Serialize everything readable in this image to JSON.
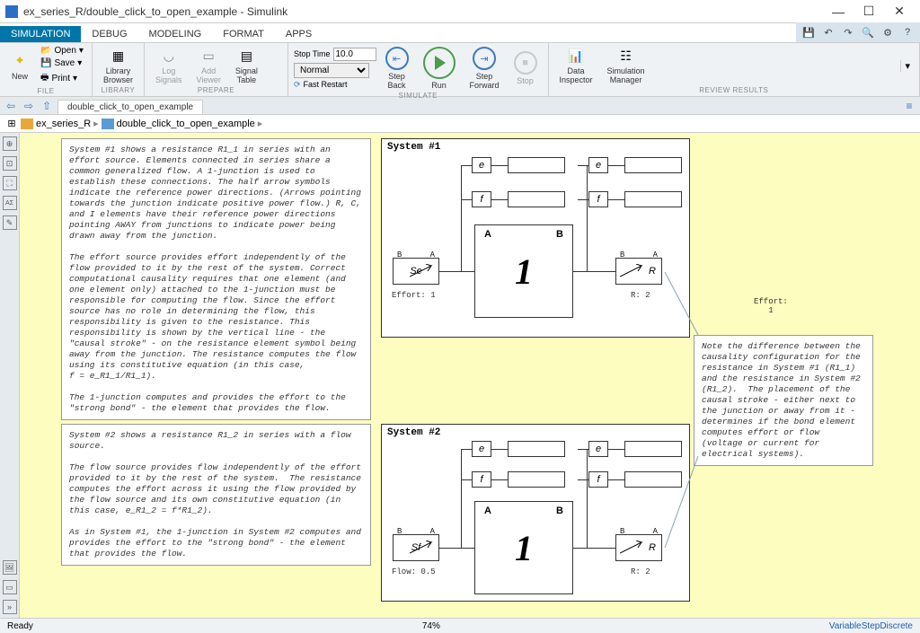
{
  "window": {
    "title": "ex_series_R/double_click_to_open_example - Simulink"
  },
  "tabs": {
    "simulation": "SIMULATION",
    "debug": "DEBUG",
    "modeling": "MODELING",
    "format": "FORMAT",
    "apps": "APPS"
  },
  "toolstrip": {
    "file": {
      "label": "FILE",
      "new": "New",
      "open": "Open",
      "save": "Save",
      "print": "Print"
    },
    "library": {
      "label": "LIBRARY",
      "browser": "Library\nBrowser"
    },
    "prepare": {
      "label": "PREPARE",
      "log": "Log\nSignals",
      "viewer": "Add\nViewer",
      "table": "Signal\nTable"
    },
    "simulate": {
      "label": "SIMULATE",
      "stoptime_lbl": "Stop Time",
      "stoptime_val": "10.0",
      "mode": "Normal",
      "fastrestart": "Fast Restart",
      "stepback": "Step\nBack",
      "run": "Run",
      "stepfwd": "Step\nForward",
      "stop": "Stop"
    },
    "review": {
      "label": "REVIEW RESULTS",
      "inspector": "Data\nInspector",
      "simmgr": "Simulation\nManager"
    }
  },
  "nav": {
    "tab": "double_click_to_open_example",
    "crumb1": "ex_series_R",
    "crumb2": "double_click_to_open_example"
  },
  "canvas": {
    "anno1": "System #1 shows a resistance R1_1 in series with an effort source. Elements connected in series share a common generalized flow. A 1-junction is used to establish these connections. The half arrow symbols indicate the reference power directions. (Arrows pointing towards the junction indicate positive power flow.) R, C, and I elements have their reference power directions pointing AWAY from junctions to indicate power being drawn away from the junction.\n\nThe effort source provides effort independently of the flow provided to it by the rest of the system. Correct computational causality requires that one element (and one element only) attached to the 1-junction must be responsible for computing the flow. Since the effort source has no role in determining the flow, this responsibility is given to the resistance. This responsibility is shown by the vertical line - the \"causal stroke\" - on the resistance element symbol being away from the junction. The resistance computes the flow using its constitutive equation (in this case,\nf = e_R1_1/R1_1).\n\nThe 1-junction computes and provides the effort to the \"strong bond\" - the element that provides the flow.",
    "anno2": "System #2 shows a resistance R1_2 in series with a flow source.\n\nThe flow source provides flow independently of the effort provided to it by the rest of the system.  The resistance computes the effort across it using the flow provided by the flow source and its own constitutive equation (in this case, e_R1_2 = f*R1_2).\n\nAs in System #1, the 1-junction in System #2 computes and provides the effort to the \"strong bond\" - the element that provides the flow.",
    "note": "Note the difference between the causality configuration for the resistance in System #1 (R1_1) and the resistance in System #2 (R1_2).  The placement of the causal stroke - either next to the junction or away from it - determines if the bond element computes effort or flow (voltage or current for electrical systems).",
    "sys1_title": "System #1",
    "sys2_title": "System #2",
    "effort_src": "Se",
    "effort_lbl": "Effort: 1",
    "flow_src": "Sf",
    "flow_lbl": "Flow: 0.5",
    "one": "1",
    "portA": "A",
    "portB": "B",
    "r_sym": "R",
    "r_lbl": "R: 2",
    "e_sym": "e",
    "f_sym": "f",
    "b_sym": "B",
    "a_sym": "A"
  },
  "status": {
    "ready": "Ready",
    "zoom": "74%",
    "solver": "VariableStepDiscrete"
  }
}
